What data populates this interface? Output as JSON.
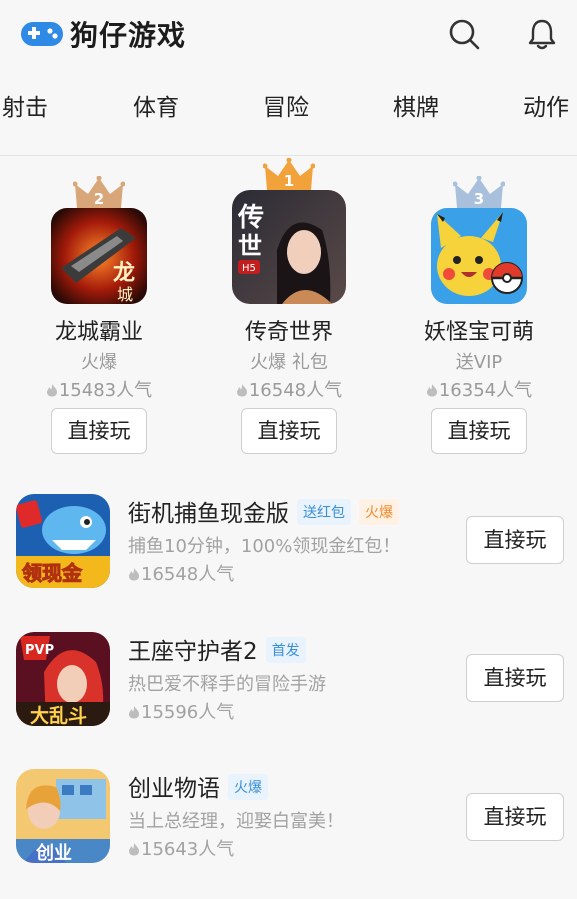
{
  "app": {
    "title": "狗仔游戏"
  },
  "header": {
    "search_icon": "search-icon",
    "notify_icon": "bell-icon"
  },
  "tabs": [
    "射击",
    "体育",
    "冒险",
    "棋牌",
    "动作"
  ],
  "podium": [
    {
      "rank": "2",
      "name": "龙城霸业",
      "tag": "火爆",
      "popularity": "15483人气",
      "button": "直接玩"
    },
    {
      "rank": "1",
      "name": "传奇世界",
      "tag": "火爆 礼包",
      "popularity": "16548人气",
      "button": "直接玩"
    },
    {
      "rank": "3",
      "name": "妖怪宝可萌",
      "tag": "送VIP",
      "popularity": "16354人气",
      "button": "直接玩"
    }
  ],
  "list": [
    {
      "name": "街机捕鱼现金版",
      "badges": [
        {
          "text": "送红包",
          "color": "blue"
        },
        {
          "text": "火爆",
          "color": "orange"
        }
      ],
      "desc": "捕鱼10分钟，100%领现金红包！",
      "popularity": "16548人气",
      "button": "直接玩",
      "icon_text": "领现金"
    },
    {
      "name": "王座守护者2",
      "badges": [
        {
          "text": "首发",
          "color": "blue"
        }
      ],
      "desc": "热巴爱不释手的冒险手游",
      "popularity": "15596人气",
      "button": "直接玩",
      "icon_text_top": "PVP",
      "icon_text": "大乱斗"
    },
    {
      "name": "创业物语",
      "badges": [
        {
          "text": "火爆",
          "color": "blue"
        }
      ],
      "desc": "当上总经理，迎娶白富美！",
      "popularity": "15643人气",
      "button": "直接玩",
      "icon_text": "创业"
    }
  ],
  "colors": {
    "accent": "#3a8fd9",
    "gold_crown": "#f2a23a",
    "bronze_crown": "#d9a67a",
    "silver_crown": "#a9c0dd"
  }
}
